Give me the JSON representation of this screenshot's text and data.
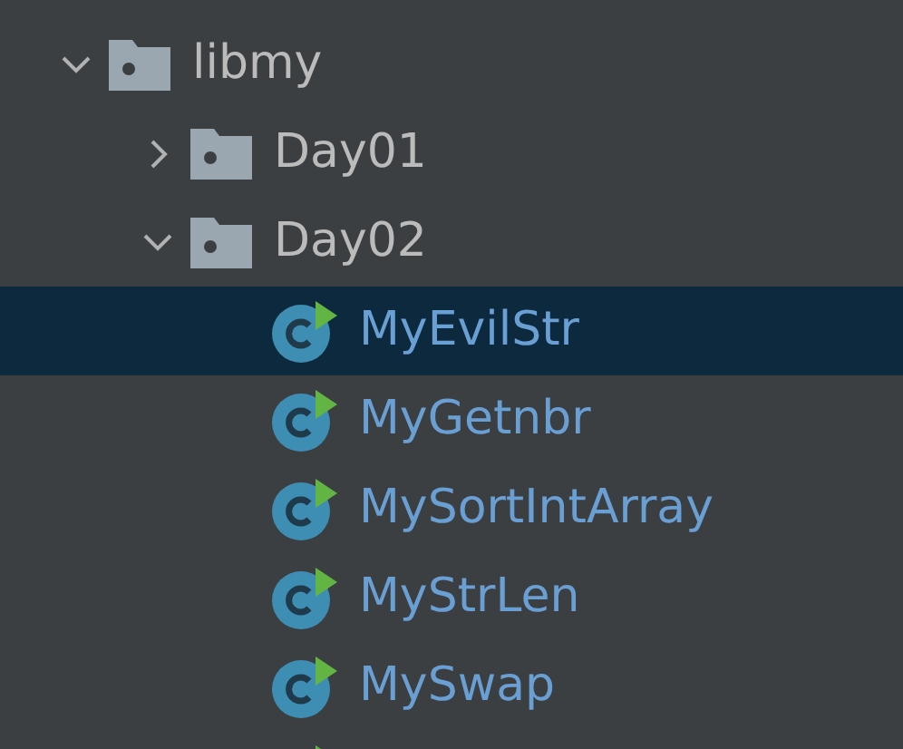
{
  "tree": [
    {
      "name": "libmy",
      "kind": "folder",
      "expanded": true,
      "selected": false,
      "children": [
        {
          "name": "Day01",
          "kind": "folder",
          "expanded": false,
          "selected": false
        },
        {
          "name": "Day02",
          "kind": "folder",
          "expanded": true,
          "selected": false,
          "children": [
            {
              "name": "MyEvilStr",
              "kind": "class",
              "selected": true
            },
            {
              "name": "MyGetnbr",
              "kind": "class",
              "selected": false
            },
            {
              "name": "MySortIntArray",
              "kind": "class",
              "selected": false
            },
            {
              "name": "MyStrLen",
              "kind": "class",
              "selected": false
            },
            {
              "name": "MySwap",
              "kind": "class",
              "selected": false
            },
            {
              "kind": "class",
              "selected": false
            }
          ]
        }
      ]
    }
  ]
}
